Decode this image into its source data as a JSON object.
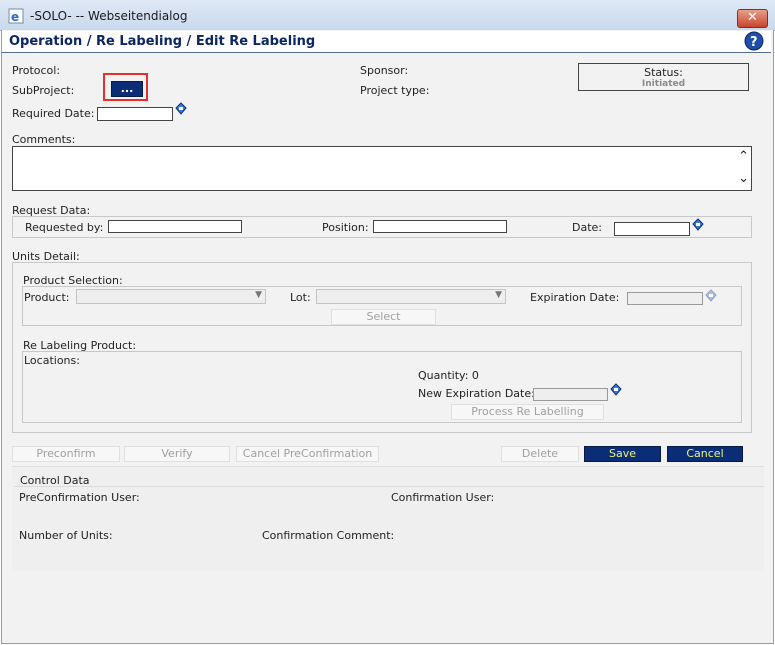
{
  "window": {
    "title": "-SOLO- -- Webseitendialog",
    "close_label": "✕"
  },
  "header": {
    "title": "Operation / Re Labeling / Edit Re Labeling"
  },
  "info": {
    "protocol_label": "Protocol:",
    "subproject_label": "SubProject:",
    "subproject_button": "...",
    "required_date_label": "Required Date:",
    "sponsor_label": "Sponsor:",
    "project_type_label": "Project type:",
    "status_label": "Status:",
    "status_value": "Initiated"
  },
  "comments": {
    "label": "Comments:",
    "value": ""
  },
  "request": {
    "section_label": "Request Data:",
    "requested_by_label": "Requested by:",
    "requested_by_value": "",
    "position_label": "Position:",
    "position_value": "",
    "date_label": "Date:",
    "date_value": ""
  },
  "units": {
    "section_label": "Units Detail:",
    "product_selection_label": "Product Selection:",
    "product_label": "Product:",
    "product_value": "",
    "lot_label": "Lot:",
    "lot_value": "",
    "expiration_date_label": "Expiration Date:",
    "select_button": "Select",
    "relabeling_product_label": "Re Labeling Product:",
    "locations_label": "Locations:",
    "quantity_label": "Quantity: 0",
    "new_expiration_label": "New Expiration Date:",
    "process_button": "Process Re Labelling"
  },
  "actions": {
    "preconfirm": "Preconfirm",
    "verify": "Verify",
    "cancel_preconfirmation": "Cancel PreConfirmation",
    "delete": "Delete",
    "save": "Save",
    "cancel": "Cancel"
  },
  "control": {
    "section_label": "Control Data",
    "preconfirmation_user_label": "PreConfirmation User:",
    "confirmation_user_label": "Confirmation User:",
    "number_of_units_label": "Number of Units:",
    "confirmation_comment_label": "Confirmation Comment:"
  },
  "colors": {
    "accent_blue": "#0b2d78",
    "save_text": "#e9f97a",
    "highlight_red": "#e8302a",
    "title_blue": "#0b2660"
  }
}
